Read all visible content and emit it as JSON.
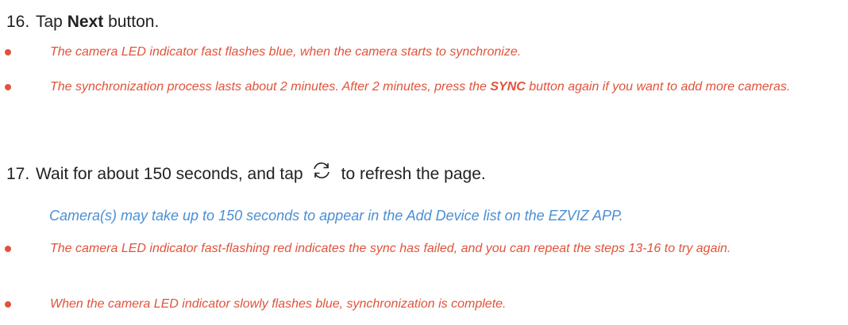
{
  "colors": {
    "step_text": "#222222",
    "note_text": "#e0533a",
    "blue_note": "#4a8fd4",
    "bullet": "#e0533a"
  },
  "step16": {
    "number": "16.",
    "prefix": "Tap",
    "bold": "Next",
    "suffix": "button."
  },
  "step16_notes": {
    "note1": "The camera LED indicator fast flashes blue, when the camera starts to synchronize.",
    "note2_a": "The synchronization process lasts about 2 minutes. After 2 minutes, press the",
    "note2_bold": "SYNC",
    "note2_b": "button again if you want to add more cameras."
  },
  "step17": {
    "number": "17.",
    "before_icon": "Wait for about 150 seconds, and tap",
    "icon": "refresh-icon",
    "after_icon": "to refresh the page."
  },
  "step17_info": "Camera(s) may take up to 150 seconds to appear in the Add Device list on the EZVIZ APP.",
  "step17_notes": {
    "note1": "The camera LED indicator fast-flashing red indicates the sync has failed, and you can repeat the steps 13-16 to try again.",
    "note2": "When the camera LED indicator slowly flashes blue, synchronization is complete."
  }
}
